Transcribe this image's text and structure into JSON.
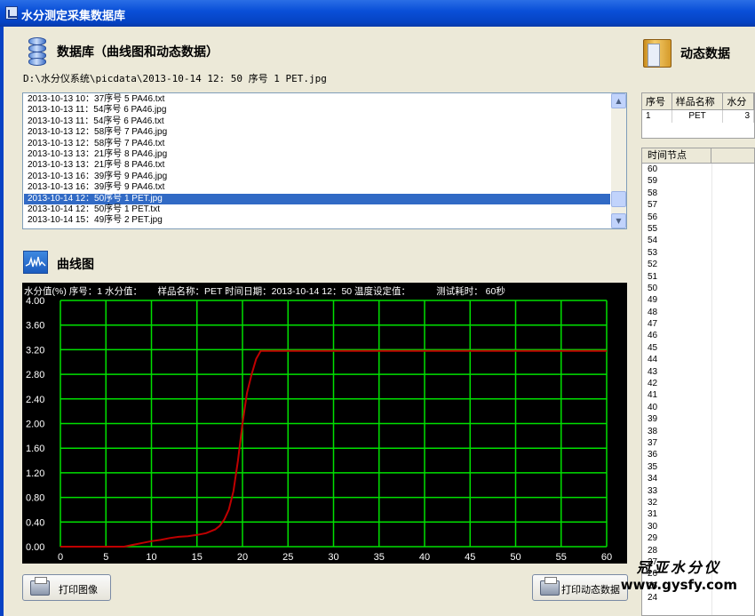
{
  "window": {
    "title": "水分测定采集数据库"
  },
  "db_section": {
    "title": "数据库（曲线图和动态数据）",
    "path": "D:\\水分仪系统\\picdata\\2013-10-14  12: 50 序号 1 PET.jpg",
    "files": [
      "2013-10-13 10：37序号 5 PA46.txt",
      "2013-10-13 11：54序号 6 PA46.jpg",
      "2013-10-13 11：54序号 6 PA46.txt",
      "2013-10-13 12：58序号 7 PA46.jpg",
      "2013-10-13 12：58序号 7 PA46.txt",
      "2013-10-13 13：21序号 8 PA46.jpg",
      "2013-10-13 13：21序号 8 PA46.txt",
      "2013-10-13 16：39序号 9 PA46.jpg",
      "2013-10-13 16：39序号 9 PA46.txt",
      "2013-10-14 12：50序号 1 PET.jpg",
      "2013-10-14 12：50序号 1 PET.txt",
      "2013-10-14 15：49序号 2 PET.jpg"
    ],
    "selected_index": 9
  },
  "curve_section": {
    "title": "曲线图",
    "header": "水分值(%) 序号：1 水分值：      样品名称：PET 时间日期：2013-10-14 12：50 温度设定值：          测试耗时： 60秒"
  },
  "chart_data": {
    "type": "line",
    "title": "",
    "xlabel": "",
    "ylabel": "水分值(%)",
    "xlim": [
      0,
      60
    ],
    "ylim": [
      0,
      4.0
    ],
    "x_ticks": [
      "0",
      "5",
      "10",
      "15",
      "20",
      "25",
      "30",
      "35",
      "40",
      "45",
      "50",
      "55",
      "60"
    ],
    "y_ticks": [
      "0.00",
      "0.40",
      "0.80",
      "1.20",
      "1.60",
      "2.00",
      "2.40",
      "2.80",
      "3.20",
      "3.60",
      "4.00"
    ],
    "grid": true,
    "series": [
      {
        "color": "#c00000",
        "x": [
          0,
          7,
          8,
          9,
          10,
          11,
          12,
          13,
          14,
          15,
          16,
          17,
          17.5,
          18,
          18.5,
          19,
          19.5,
          20,
          20.5,
          21,
          21.5,
          22,
          23,
          25,
          30,
          35,
          40,
          45,
          50,
          55,
          60
        ],
        "y": [
          0.0,
          0.0,
          0.03,
          0.06,
          0.09,
          0.11,
          0.14,
          0.16,
          0.17,
          0.19,
          0.22,
          0.28,
          0.34,
          0.44,
          0.6,
          0.9,
          1.4,
          2.0,
          2.5,
          2.8,
          3.05,
          3.18,
          3.18,
          3.18,
          3.18,
          3.18,
          3.18,
          3.18,
          3.18,
          3.18,
          3.18
        ]
      }
    ]
  },
  "dynamic_section": {
    "title": "动态数据",
    "info_columns": [
      "序号",
      "样品名称",
      "水分"
    ],
    "info_row": [
      "1",
      "PET",
      "3"
    ],
    "time_header": "时间节点",
    "time_rows": [
      "60",
      "59",
      "58",
      "57",
      "56",
      "55",
      "54",
      "53",
      "52",
      "51",
      "50",
      "49",
      "48",
      "47",
      "46",
      "45",
      "44",
      "43",
      "42",
      "41",
      "40",
      "39",
      "38",
      "37",
      "36",
      "35",
      "34",
      "33",
      "32",
      "31",
      "30",
      "29",
      "28",
      "27",
      "26",
      "25",
      "24"
    ]
  },
  "buttons": {
    "print_image": "打印图像",
    "print_dynamic": "打印动态数据"
  },
  "watermark": {
    "line1": "冠亚水分仪",
    "line2": "www.gysfy.com"
  },
  "colors": {
    "titlebar": "#0a50d8",
    "grid": "#00e000",
    "curve": "#c00000",
    "selection": "#316ac5"
  }
}
